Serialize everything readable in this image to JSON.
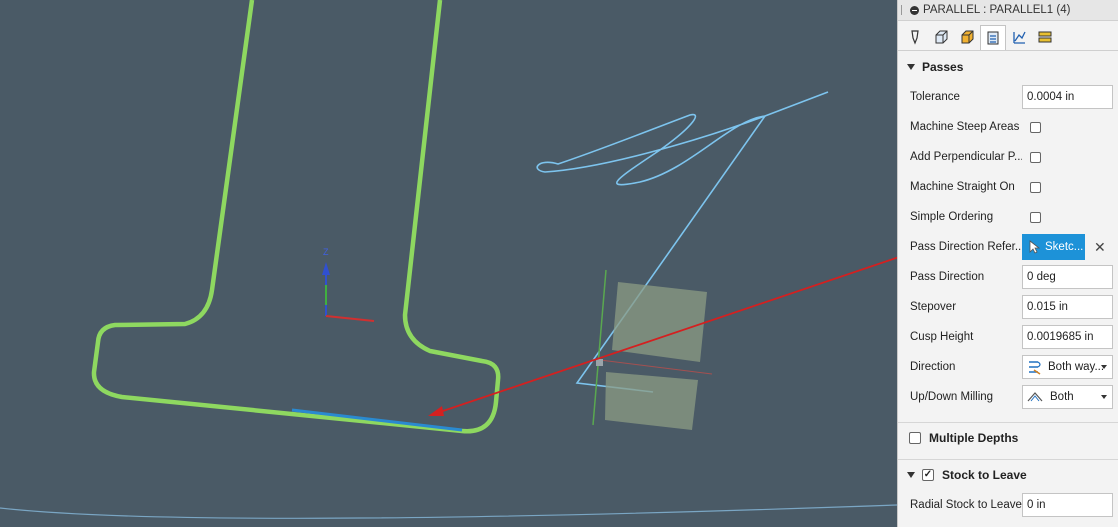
{
  "panel": {
    "title": "PARALLEL : PARALLEL1 (4)",
    "tabs": [
      {
        "icon": "tool-icon"
      },
      {
        "icon": "geometry-icon"
      },
      {
        "icon": "heights-icon"
      },
      {
        "icon": "passes-icon"
      },
      {
        "icon": "linking-icon"
      },
      {
        "icon": "post-process-icon"
      }
    ],
    "passes": {
      "header": "Passes",
      "tolerance_label": "Tolerance",
      "tolerance_value": "0.0004 in",
      "machine_steep_label": "Machine Steep Areas",
      "add_perp_label": "Add Perpendicular P...",
      "machine_straight_label": "Machine Straight On",
      "simple_ordering_label": "Simple Ordering",
      "pass_dir_ref_label": "Pass Direction Refer...",
      "pass_dir_ref_button": "Sketc...",
      "clear_symbol": "✕",
      "pass_direction_label": "Pass Direction",
      "pass_direction_value": "0 deg",
      "stepover_label": "Stepover",
      "stepover_value": "0.015 in",
      "cusp_height_label": "Cusp Height",
      "cusp_height_value": "0.0019685 in",
      "direction_label": "Direction",
      "direction_value": "Both way...",
      "updown_label": "Up/Down Milling",
      "updown_value": "Both"
    },
    "multiple_depths": {
      "header": "Multiple Depths",
      "checked": false
    },
    "stock_to_leave": {
      "header": "Stock to Leave",
      "checked": true,
      "check_mark": "✓",
      "radial_label": "Radial Stock to Leave",
      "radial_value": "0 in"
    }
  },
  "viewport": {
    "axis_z_label": "Z",
    "colors": {
      "background": "#4a5a66",
      "profile_path": "#8ed860",
      "sketch": "#7dc4ee",
      "selected_edge": "#2a8ad0",
      "arrow": "#d42020"
    }
  }
}
